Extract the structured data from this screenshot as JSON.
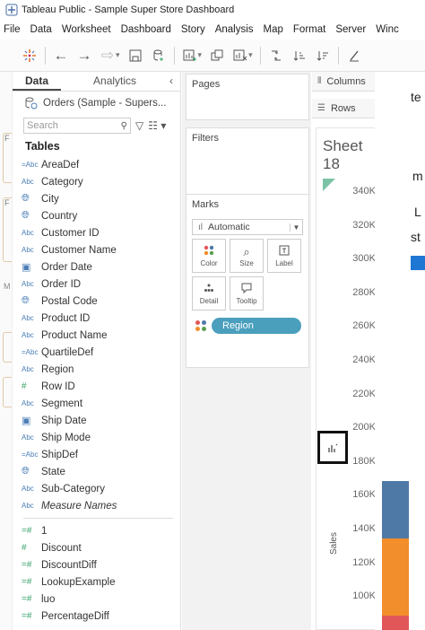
{
  "window": {
    "title": "Tableau Public - Sample Super Store Dashboard"
  },
  "menu": [
    "File",
    "Data",
    "Worksheet",
    "Dashboard",
    "Story",
    "Analysis",
    "Map",
    "Format",
    "Server",
    "Winc"
  ],
  "data_pane": {
    "tabs": [
      "Data",
      "Analytics"
    ],
    "collapse": "‹",
    "datasource": "Orders (Sample - Supers...",
    "search_placeholder": "Search",
    "tables_heading": "Tables",
    "dimensions": [
      {
        "type": "abc-calc",
        "name": "AreaDef"
      },
      {
        "type": "abc",
        "name": "Category"
      },
      {
        "type": "globe",
        "name": "City"
      },
      {
        "type": "globe",
        "name": "Country"
      },
      {
        "type": "abc",
        "name": "Customer ID"
      },
      {
        "type": "abc",
        "name": "Customer Name"
      },
      {
        "type": "calendar",
        "name": "Order Date"
      },
      {
        "type": "abc",
        "name": "Order ID"
      },
      {
        "type": "globe",
        "name": "Postal Code"
      },
      {
        "type": "abc",
        "name": "Product ID"
      },
      {
        "type": "abc",
        "name": "Product Name"
      },
      {
        "type": "abc-calc",
        "name": "QuartileDef"
      },
      {
        "type": "abc",
        "name": "Region"
      },
      {
        "type": "hash",
        "name": "Row ID"
      },
      {
        "type": "abc",
        "name": "Segment"
      },
      {
        "type": "calendar",
        "name": "Ship Date"
      },
      {
        "type": "abc",
        "name": "Ship Mode"
      },
      {
        "type": "abc-calc",
        "name": "ShipDef"
      },
      {
        "type": "globe",
        "name": "State"
      },
      {
        "type": "abc",
        "name": "Sub-Category"
      },
      {
        "type": "abc",
        "name": "Measure Names"
      }
    ],
    "measures": [
      {
        "type": "hash-calc",
        "name": "1"
      },
      {
        "type": "hash",
        "name": "Discount"
      },
      {
        "type": "hash-calc",
        "name": "DiscountDiff"
      },
      {
        "type": "hash-calc",
        "name": "LookupExample"
      },
      {
        "type": "hash-calc",
        "name": "luo"
      },
      {
        "type": "hash-calc",
        "name": "PercentageDiff"
      }
    ]
  },
  "shelves": {
    "pages": "Pages",
    "filters": "Filters",
    "marks": "Marks",
    "mark_type": "Automatic",
    "mark_buttons": [
      "Color",
      "Size",
      "Label",
      "Detail",
      "Tooltip"
    ],
    "region_pill": "Region",
    "columns": "Columns",
    "rows": "Rows"
  },
  "view": {
    "sheet_title": "Sheet 18",
    "y_ticks": [
      "340K",
      "320K",
      "300K",
      "280K",
      "260K",
      "240K",
      "220K",
      "200K",
      "180K",
      "160K",
      "140K",
      "120K",
      "100K"
    ],
    "axis_label": "Sales",
    "right_text": [
      "te",
      "m",
      "L",
      "st"
    ],
    "colors": {
      "blue": "#4e79a7",
      "orange": "#f28e2b",
      "red": "#e15759",
      "accent_blue": "#1f77d4",
      "pill": "#4a9fbd"
    }
  }
}
